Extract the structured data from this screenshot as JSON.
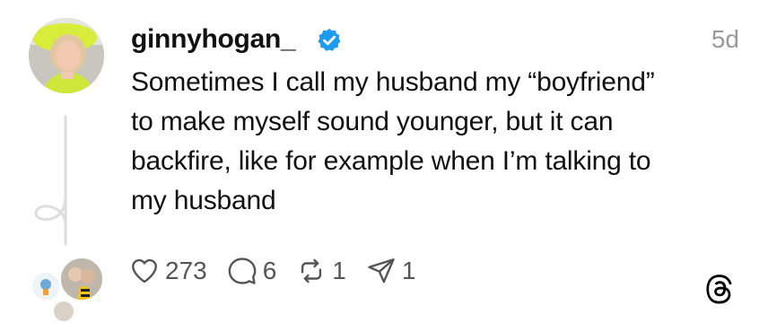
{
  "post": {
    "username": "ginnyhogan_",
    "timestamp": "5d",
    "text_lines": [
      "Sometimes I call my husband my “boyfriend”",
      "to make myself sound younger, but it can",
      "backfire, like for example when I’m talking to",
      "my husband"
    ]
  },
  "actions": {
    "likes": "273",
    "replies": "6",
    "reposts": "1",
    "shares": "1"
  },
  "icons": {
    "verified": "verified-badge-icon",
    "like": "heart-icon",
    "reply": "speech-bubble-icon",
    "repost": "repost-arrows-icon",
    "share": "send-arrow-icon",
    "brand": "threads-logo-icon"
  },
  "colors": {
    "verified_blue": "#1d9bf0",
    "muted_text": "#999999",
    "icon_gray": "#555555"
  }
}
